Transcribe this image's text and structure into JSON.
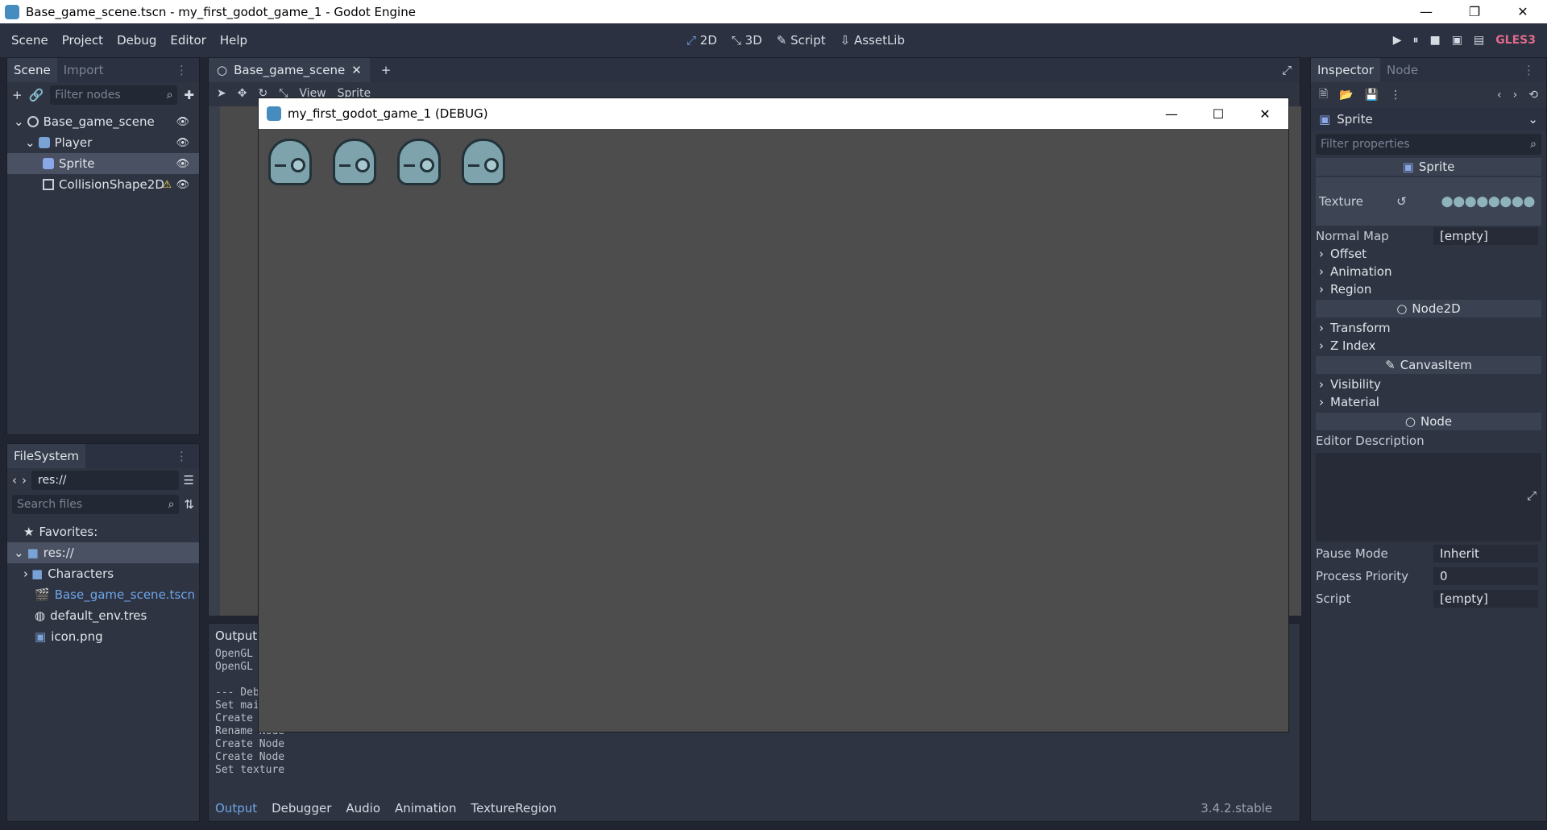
{
  "os_window": {
    "title": "Base_game_scene.tscn - my_first_godot_game_1 - Godot Engine",
    "min": "—",
    "max": "❐",
    "close": "✕"
  },
  "menu": {
    "items": [
      "Scene",
      "Project",
      "Debug",
      "Editor",
      "Help"
    ],
    "modes": [
      "2D",
      "3D",
      "Script",
      "AssetLib"
    ],
    "active_mode": "2D",
    "play_buttons": [
      "▶",
      "⏸",
      "■",
      "▣",
      "▤"
    ],
    "renderer": "GLES3"
  },
  "scene_dock": {
    "tabs": [
      "Scene",
      "Import"
    ],
    "active_tab": "Scene",
    "filter_placeholder": "Filter nodes",
    "nodes": [
      {
        "label": "Base_game_scene",
        "indent": 0,
        "icon": "node-circle-icon"
      },
      {
        "label": "Player",
        "indent": 1,
        "icon": "kinematic-body-icon"
      },
      {
        "label": "Sprite",
        "indent": 2,
        "icon": "sprite-icon",
        "selected": true
      },
      {
        "label": "CollisionShape2D",
        "indent": 2,
        "icon": "collision-shape-icon",
        "warning": true
      }
    ]
  },
  "filesystem_dock": {
    "tab": "FileSystem",
    "path": "res://",
    "search_placeholder": "Search files",
    "items": [
      {
        "label": "Favorites:",
        "icon": "star-icon"
      },
      {
        "label": "res://",
        "icon": "folder-icon",
        "selected": true
      },
      {
        "label": "Characters",
        "icon": "folder-icon"
      },
      {
        "label": "Base_game_scene.tscn",
        "icon": "scene-file-icon",
        "link": true
      },
      {
        "label": "default_env.tres",
        "icon": "environment-icon"
      },
      {
        "label": "icon.png",
        "icon": "image-icon"
      }
    ]
  },
  "editor": {
    "scene_tab": "Base_game_scene",
    "toolbar": {
      "view": "View",
      "sprite": "Sprite"
    }
  },
  "output": {
    "title": "Output:",
    "log_lines": [
      "OpenGL",
      "OpenGL",
      "",
      "--- Deb",
      "Set mai",
      "Create",
      "Rename Node",
      "Create Node",
      "Create Node",
      "Set texture"
    ],
    "bottom_tabs": [
      "Output",
      "Debugger",
      "Audio",
      "Animation",
      "TextureRegion"
    ],
    "active_tab": "Output",
    "version": "3.4.2.stable"
  },
  "debug_window": {
    "title": "my_first_godot_game_1 (DEBUG)",
    "sprite_count": 4
  },
  "inspector": {
    "tabs": [
      "Inspector",
      "Node"
    ],
    "active_tab": "Inspector",
    "object": "Sprite",
    "filter_placeholder": "Filter properties",
    "sections": {
      "sprite": "Sprite",
      "node2d": "Node2D",
      "canvasitem": "CanvasItem",
      "node": "Node"
    },
    "texture_label": "Texture",
    "normal_map_label": "Normal Map",
    "normal_map_value": "[empty]",
    "sprite_groups": [
      "Offset",
      "Animation",
      "Region"
    ],
    "node2d_groups": [
      "Transform",
      "Z Index"
    ],
    "canvas_groups": [
      "Visibility",
      "Material"
    ],
    "editor_description": "Editor Description",
    "pause_mode_label": "Pause Mode",
    "pause_mode_value": "Inherit",
    "process_priority_label": "Process Priority",
    "process_priority_value": "0",
    "script_label": "Script",
    "script_value": "[empty]"
  }
}
